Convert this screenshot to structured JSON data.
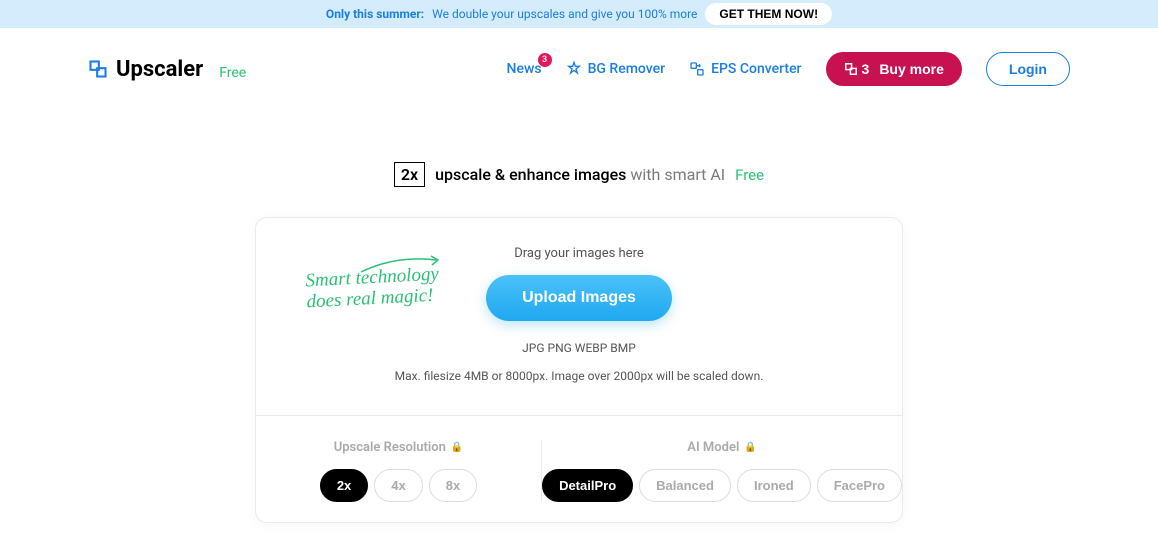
{
  "promo": {
    "strong": "Only this summer:",
    "text": "We double your upscales and give you 100% more",
    "cta": "GET THEM NOW!"
  },
  "header": {
    "logo_text": "Upscaler",
    "free_label": "Free",
    "nav": {
      "news": "News",
      "news_badge": "3",
      "bg_remover": "BG Remover",
      "eps_converter": "EPS Converter"
    },
    "credits": "3",
    "buy_more": "Buy more",
    "login": "Login"
  },
  "headline": {
    "box": "2x",
    "main": "upscale & enhance images",
    "sub": "with smart AI",
    "free": "Free"
  },
  "upload": {
    "drag_text": "Drag your images here",
    "button": "Upload Images",
    "formats": "JPG PNG WEBP BMP",
    "limits": "Max. filesize 4MB or 8000px. Image over 2000px will be scaled down.",
    "handwritten_line1": "Smart technology",
    "handwritten_line2": "does real magic!"
  },
  "options": {
    "resolution_label": "Upscale Resolution",
    "resolutions": [
      "2x",
      "4x",
      "8x"
    ],
    "resolution_selected": "2x",
    "model_label": "AI Model",
    "models": [
      "DetailPro",
      "Balanced",
      "Ironed",
      "FacePro"
    ],
    "model_selected": "DetailPro"
  }
}
